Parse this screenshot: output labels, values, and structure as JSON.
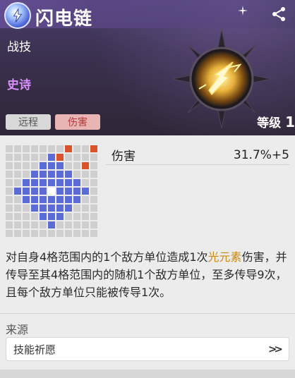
{
  "header": {
    "title": "闪电链",
    "category": "战技",
    "rarity": "史诗",
    "tags": [
      "远程",
      "伤害"
    ],
    "level_label": "等级",
    "level_value": "1",
    "badge_icon": "lightning-swirl-icon",
    "share_icon": "share-icon",
    "accent_color": "#d890ff"
  },
  "stats": [
    {
      "name": "伤害",
      "value": "31.7%+5"
    }
  ],
  "description": {
    "before": "对自身4格范围内的1个敌方单位造成1次",
    "highlight": "光元素",
    "after": "伤害，并传导至其4格范围内的随机1个敌方单位，至多传导9次，且每个敌方单位只能被传导1次。",
    "highlight_color": "#c98a16"
  },
  "source": {
    "label": "来源",
    "button_label": "技能祈愿"
  },
  "range_grid": {
    "rows": 11,
    "cols": 11,
    "colors": {
      "empty": "#cfcfcf",
      "range": "#5b6cd6",
      "center": "#ffffff",
      "enemy": "#d9542b"
    },
    "range_cells": [
      [
        1,
        5
      ],
      [
        2,
        4
      ],
      [
        2,
        5
      ],
      [
        2,
        6
      ],
      [
        3,
        3
      ],
      [
        3,
        4
      ],
      [
        3,
        5
      ],
      [
        3,
        6
      ],
      [
        3,
        7
      ],
      [
        4,
        2
      ],
      [
        4,
        3
      ],
      [
        4,
        4
      ],
      [
        4,
        5
      ],
      [
        4,
        6
      ],
      [
        4,
        7
      ],
      [
        4,
        8
      ],
      [
        5,
        1
      ],
      [
        5,
        2
      ],
      [
        5,
        3
      ],
      [
        5,
        4
      ],
      [
        5,
        6
      ],
      [
        5,
        7
      ],
      [
        5,
        8
      ],
      [
        5,
        9
      ],
      [
        6,
        2
      ],
      [
        6,
        3
      ],
      [
        6,
        4
      ],
      [
        6,
        5
      ],
      [
        6,
        6
      ],
      [
        6,
        7
      ],
      [
        6,
        8
      ],
      [
        7,
        3
      ],
      [
        7,
        4
      ],
      [
        7,
        5
      ],
      [
        7,
        6
      ],
      [
        7,
        7
      ],
      [
        8,
        4
      ],
      [
        8,
        5
      ],
      [
        8,
        6
      ],
      [
        9,
        5
      ]
    ],
    "center_cell": [
      5,
      5
    ],
    "enemy_cells": [
      [
        0,
        7
      ],
      [
        0,
        10
      ],
      [
        1,
        6
      ],
      [
        2,
        9
      ]
    ]
  }
}
